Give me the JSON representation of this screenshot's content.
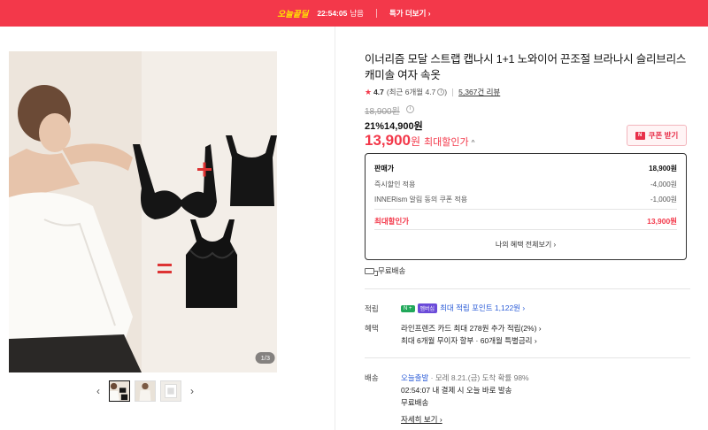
{
  "topbar": {
    "brand": "오늘끝딜",
    "timer": "22:54:05",
    "remaining": "남음",
    "deals_link": "특가 더보기 ›"
  },
  "gallery": {
    "counter": "1/3",
    "prev": "‹",
    "next": "›",
    "thumb_count": 3
  },
  "product": {
    "title": "이너리즘 모달 스트랩 캡나시 1+1 노와이어 끈조절 브라나시 슬리브리스 캐미솔 여자 속옷",
    "rating": "4.7",
    "rating_meta": "(최근 6개월 4.7",
    "rating_meta_end": ")",
    "reviews": "5,367건 리뷰",
    "original_price": "18,900원",
    "discounted": "21%14,900원",
    "max_price_num": "13,900",
    "max_price_won": "원",
    "max_price_label": "최대할인가",
    "coupon_button": "쿠폰 받기"
  },
  "pricebox": {
    "rows": [
      {
        "label": "판매가",
        "value": "18,900원"
      },
      {
        "label": "즉시할인 적용",
        "value": "-4,000원"
      },
      {
        "label": "INNERism 알림 동의 쿠폰 적용",
        "value": "-1,000원"
      }
    ],
    "total_label": "최대할인가",
    "total_value": "13,900원",
    "benefit_link": "나의 혜택 전체보기 ›"
  },
  "shipping_free": "무료배송",
  "points": {
    "label": "적립",
    "badge1": "N +",
    "badge2": "멤버십",
    "text": "최대 적립 포인트 1,122원 ›"
  },
  "benefits": {
    "label": "혜택",
    "line1": "라인프렌즈 카드 최대 278원 추가 적립(2%) ›",
    "line2": "최대 6개월 무이자 할부 · 60개월 특별금리 ›"
  },
  "delivery": {
    "label": "배송",
    "service": "오늘출발",
    "line1_rest": "· 모레 8.21.(금) 도착 확률 98%",
    "line2": "02:54:07  내 결제 시 오늘 바로 발송",
    "line3": "무료배송",
    "detail_link": "자세히 보기 ›"
  },
  "colors": {
    "accent": "#f3384a",
    "link_blue": "#2a5bd7",
    "membership_green": "#21a85a"
  }
}
